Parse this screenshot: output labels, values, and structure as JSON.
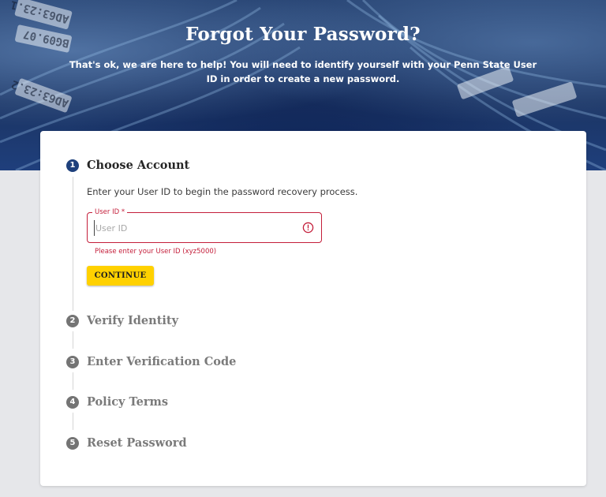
{
  "header": {
    "title": "Forgot Your Password?",
    "subtitle": "That's ok, we are here to help! You will need to identify yourself with your Penn State User ID in order to create a new password."
  },
  "steps": [
    {
      "number": "1",
      "label": "Choose Account",
      "state": "active"
    },
    {
      "number": "2",
      "label": "Verify Identity",
      "state": "inactive"
    },
    {
      "number": "3",
      "label": "Enter Verification Code",
      "state": "inactive"
    },
    {
      "number": "4",
      "label": "Policy Terms",
      "state": "inactive"
    },
    {
      "number": "5",
      "label": "Reset Password",
      "state": "inactive"
    }
  ],
  "choose_account": {
    "instruction": "Enter your User ID to begin the password recovery process.",
    "field_label": "User ID *",
    "field_placeholder": "User ID",
    "field_value": "",
    "error_text": "Please enter your User ID (xyz5000)",
    "continue_label": "CONTINUE"
  },
  "colors": {
    "brand_navy": "#1e407c",
    "accent_yellow": "#ffd100",
    "error_red": "#c41e3a",
    "inactive_gray": "#747474"
  },
  "icons": {
    "field_error": "error-circle-icon"
  },
  "background_text": [
    "AD63:23.1",
    "BG09.07",
    "AD63:23.2"
  ]
}
